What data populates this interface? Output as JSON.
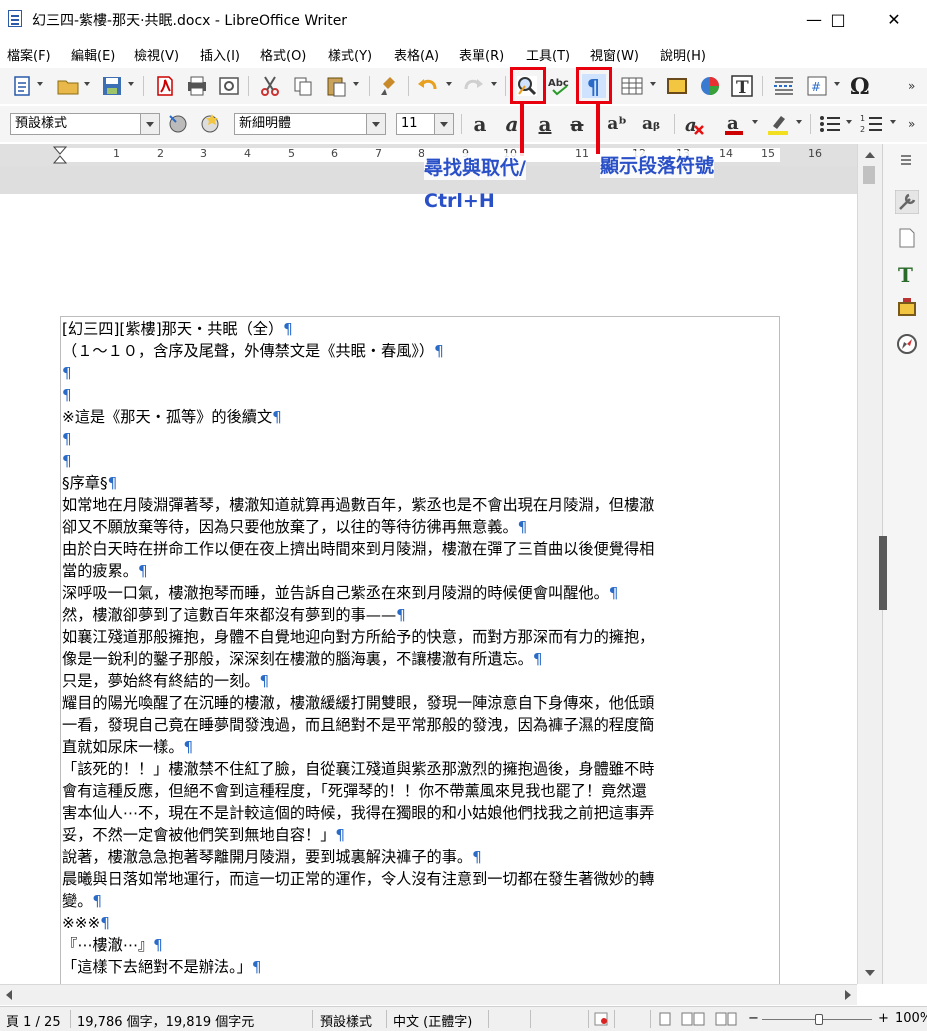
{
  "window": {
    "title": "幻三四-紫樓-那天·共眠.docx - LibreOffice Writer",
    "minimize": "—",
    "maximize": "□",
    "close": "✕"
  },
  "menu": [
    "檔案(F)",
    "編輯(E)",
    "檢視(V)",
    "插入(I)",
    "格式(O)",
    "樣式(Y)",
    "表格(A)",
    "表單(R)",
    "工具(T)",
    "視窗(W)",
    "說明(H)"
  ],
  "toolbar2": {
    "paragraph_style": "預設樣式",
    "font_name": "新細明體",
    "font_size": "11"
  },
  "ruler": {
    "labels": [
      "1",
      "2",
      "3",
      "4",
      "5",
      "6",
      "7",
      "8",
      "9",
      "10",
      "11",
      "12",
      "13",
      "14",
      "15",
      "16"
    ]
  },
  "annotations": {
    "find_replace": "尋找與取代/",
    "find_replace_shortcut": "Ctrl+H",
    "show_formatting_marks": "顯示段落符號"
  },
  "document": {
    "lines": [
      {
        "text": "[幻三四][紫樓]那天・共眠（全）",
        "mark": "¶"
      },
      {
        "text": "（１～１０，含序及尾聲，外傳禁文是《共眠・春風》）",
        "mark": "¶"
      },
      {
        "text": "",
        "mark": "¶"
      },
      {
        "text": "",
        "mark": "¶"
      },
      {
        "text": "※這是《那天・孤等》的後續文",
        "mark": "¶"
      },
      {
        "text": "",
        "mark": "¶"
      },
      {
        "text": "",
        "mark": "¶"
      },
      {
        "text": "§序章§",
        "mark": "¶"
      },
      {
        "text": "如常地在月陵淵彈著琴，樓澈知道就算再過數百年，紫丞也是不會出現在月陵淵，但樓澈",
        "mark": ""
      },
      {
        "text": "卻又不願放棄等待，因為只要他放棄了，以往的等待彷彿再無意義。",
        "mark": "¶"
      },
      {
        "text": "由於白天時在拼命工作以便在夜上擠出時間來到月陵淵，樓澈在彈了三首曲以後便覺得相",
        "mark": ""
      },
      {
        "text": "當的疲累。",
        "mark": "¶"
      },
      {
        "text": "深呼吸一口氣，樓澈抱琴而睡，並告訴自己紫丞在來到月陵淵的時候便會叫醒他。",
        "mark": "¶"
      },
      {
        "text": "然，樓澈卻夢到了這數百年來都沒有夢到的事——",
        "mark": "¶"
      },
      {
        "text": "如襄江殘道那般擁抱，身體不自覺地迎向對方所給予的快意，而對方那深而有力的擁抱，",
        "mark": ""
      },
      {
        "text": "像是一銳利的鑿子那般，深深刻在樓澈的腦海裏，不讓樓澈有所遺忘。",
        "mark": "¶"
      },
      {
        "text": "只是，夢始終有終結的一刻。",
        "mark": "¶"
      },
      {
        "text": "耀目的陽光喚醒了在沉睡的樓澈，樓澈緩緩打開雙眼，發現一陣涼意自下身傳來，他低頭",
        "mark": ""
      },
      {
        "text": "一看，發現自己竟在睡夢間發洩過，而且絕對不是平常那般的發洩，因為褲子濕的程度簡",
        "mark": ""
      },
      {
        "text": "直就如尿床一樣。",
        "mark": "¶"
      },
      {
        "text": "「該死的！！」樓澈禁不住紅了臉，自從襄江殘道與紫丞那激烈的擁抱過後，身體雖不時",
        "mark": ""
      },
      {
        "text": "會有這種反應，但絕不會到這種程度，「死彈琴的！！你不帶薰風來見我也罷了！竟然還",
        "mark": ""
      },
      {
        "text": "害本仙人⋯不，現在不是計較這個的時候，我得在獨眼的和小姑娘他們找我之前把這事弄",
        "mark": ""
      },
      {
        "text": "妥，不然一定會被他們笑到無地自容！」",
        "mark": "¶"
      },
      {
        "text": "說著，樓澈急急抱著琴離開月陵淵，要到城裏解決褲子的事。",
        "mark": "¶"
      },
      {
        "text": "晨曦與日落如常地運行，而這一切正常的運作，令人沒有注意到一切都在發生著微妙的轉",
        "mark": ""
      },
      {
        "text": "變。",
        "mark": "¶"
      },
      {
        "text": "※※※",
        "mark": "¶"
      },
      {
        "text": "『⋯樓澈⋯』",
        "mark": "¶"
      },
      {
        "text": "「這樣下去絕對不是辦法。」",
        "mark": "¶"
      }
    ]
  },
  "status": {
    "page": "頁 1 / 25",
    "words": "19,786 個字，19,819 個字元",
    "page_style": "預設樣式",
    "language": "中文 (正體字)",
    "zoom": "100%"
  },
  "colors": {
    "accent_red": "#e8000e",
    "callout_blue": "#2a50c8",
    "pilcrow_blue": "#2a6bc8"
  }
}
